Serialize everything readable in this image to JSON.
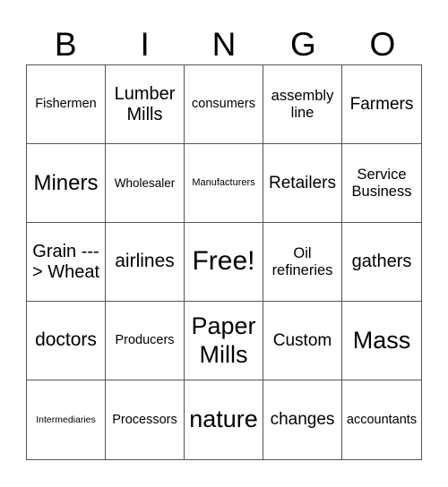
{
  "header": [
    "B",
    "I",
    "N",
    "G",
    "O"
  ],
  "cells": [
    [
      "Fishermen",
      "Lumber Mills",
      "consumers",
      "assembly line",
      "Farmers"
    ],
    [
      "Miners",
      "Wholesaler",
      "Manufacturers",
      "Retailers",
      "Service Business"
    ],
    [
      "Grain ---> Wheat",
      "airlines",
      "Free!",
      "Oil refineries",
      "gathers"
    ],
    [
      "doctors",
      "Producers",
      "Paper Mills",
      "Custom",
      "Mass"
    ],
    [
      "Intermediaries",
      "Processors",
      "nature",
      "changes",
      "accountants"
    ]
  ]
}
